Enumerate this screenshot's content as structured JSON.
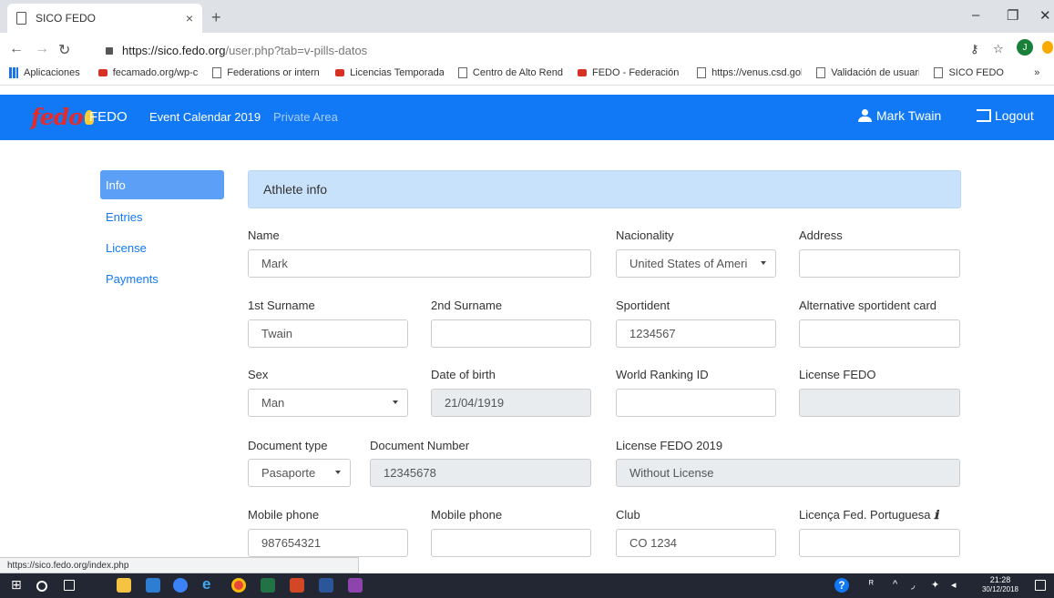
{
  "browser": {
    "tab_title": "SICO FEDO",
    "tab_close": "×",
    "new_tab": "+",
    "url_host": "https://sico.fedo.org",
    "url_path": "/user.php?tab=v-pills-datos",
    "status_url": "https://sico.fedo.org/index.php",
    "profile_initial": "J",
    "bookmarks": [
      "Aplicaciones",
      "fecamado.org/wp-co",
      "Federations or intern",
      "Licencias Temporada",
      "Centro de Alto Rendi",
      "FEDO - Federación E",
      "https://venus.csd.gob",
      "Validación de usuario",
      "SICO FEDO"
    ],
    "more_bookmarks": "»"
  },
  "navbar": {
    "logo": "fedo",
    "brand": "FEDO",
    "links": [
      "Event Calendar 2019",
      "Private Area"
    ],
    "user": "Mark Twain",
    "logout": "Logout"
  },
  "sidebar": {
    "items": [
      "Info",
      "Entries",
      "License",
      "Payments"
    ]
  },
  "form": {
    "header": "Athlete info",
    "name_label": "Name",
    "name_value": "Mark",
    "nationality_label": "Nacionality",
    "nationality_value": "United States of Ameri",
    "address_label": "Address",
    "address_value": "",
    "surname1_label": "1st Surname",
    "surname1_value": "Twain",
    "surname2_label": "2nd Surname",
    "surname2_value": "",
    "sportident_label": "Sportident",
    "sportident_value": "1234567",
    "alt_sportident_label": "Alternative sportident card",
    "alt_sportident_value": "",
    "sex_label": "Sex",
    "sex_value": "Man",
    "dob_label": "Date of birth",
    "dob_value": "21/04/1919",
    "wrid_label": "World Ranking ID",
    "wrid_value": "",
    "license_fedo_label": "License FEDO",
    "license_fedo_value": "",
    "doctype_label": "Document type",
    "doctype_value": "Pasaporte",
    "docnum_label": "Document Number",
    "docnum_value": "12345678",
    "license2019_label": "License FEDO 2019",
    "license2019_value": "Without License",
    "mobile1_label": "Mobile phone",
    "mobile1_value": "987654321",
    "mobile2_label": "Mobile phone",
    "mobile2_value": "",
    "club_label": "Club",
    "club_value": "CO 1234",
    "portuguesa_label": "Licença Fed. Portuguesa",
    "portuguesa_info": "ℹ",
    "portuguesa_value": ""
  },
  "taskbar": {
    "time": "21:28",
    "date": "30/12/2018"
  },
  "colors": {
    "navbar": "#1279f6",
    "accent": "#1279f6",
    "header_bg": "#c9e2fb",
    "logo_red": "#e32b2b"
  }
}
